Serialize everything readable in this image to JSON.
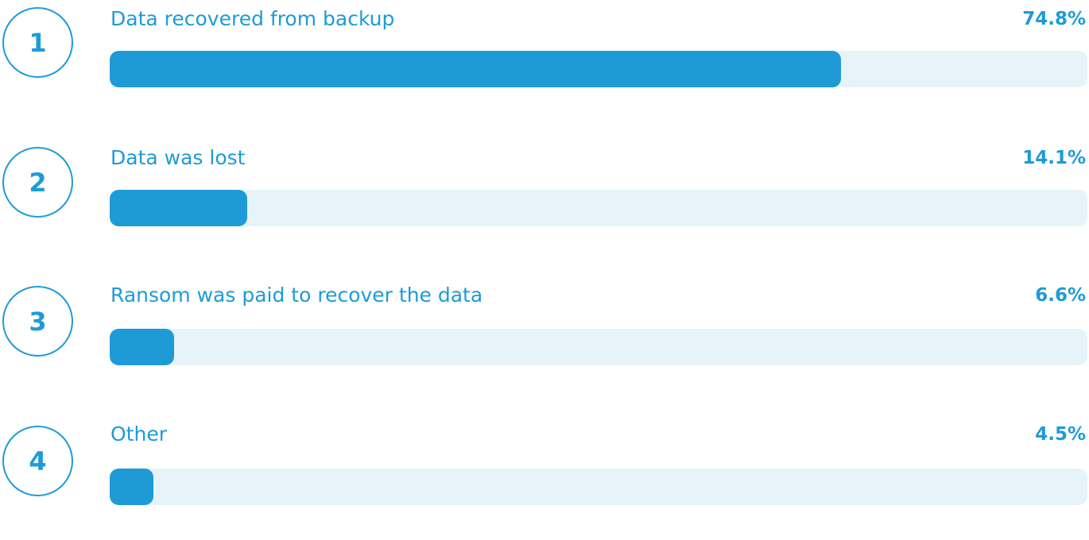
{
  "colors": {
    "accent": "#1e9bd7",
    "track": "#e6f4fa"
  },
  "chart_data": {
    "type": "bar",
    "orientation": "horizontal",
    "categories": [
      "Data recovered from backup",
      "Data was lost",
      "Ransom was paid to recover the data",
      "Other"
    ],
    "values": [
      74.8,
      14.1,
      6.6,
      4.5
    ],
    "value_labels": [
      "74.8%",
      "14.1%",
      "6.6%",
      "4.5%"
    ],
    "rank_labels": [
      "1",
      "2",
      "3",
      "4"
    ],
    "unit": "%",
    "xlim": [
      0,
      100
    ]
  }
}
